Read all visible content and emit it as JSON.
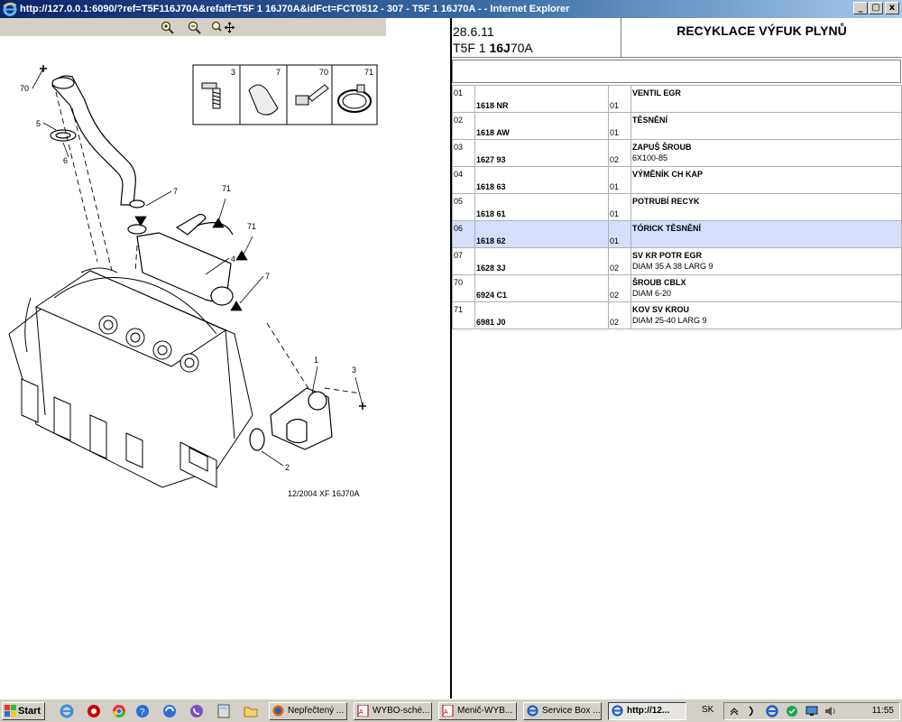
{
  "window": {
    "title": "http://127.0.0.1:6090/?ref=T5F116J70A&refaff=T5F 1 16J70A&idFct=FCT0512 - 307 - T5F 1 16J70A - - Internet Explorer"
  },
  "toolbar": {
    "zoom_in": "zoom-in",
    "zoom_out": "zoom-out",
    "zoom_pan": "zoom-pan"
  },
  "diagram": {
    "callouts": [
      "70",
      "5",
      "6",
      "7",
      "71",
      "4",
      "71",
      "7",
      "1",
      "3",
      "2"
    ],
    "legend": [
      {
        "num": "3",
        "part": "screw"
      },
      {
        "num": "7",
        "part": "clamp"
      },
      {
        "num": "70",
        "part": "screw"
      },
      {
        "num": "71",
        "part": "hose-clip"
      }
    ],
    "caption": "12/2004  XF 16J70A"
  },
  "header": {
    "date": "28.6.11",
    "model_prefix": "T5F 1",
    "model_bold": "16J",
    "model_suffix": "70A",
    "title": "RECYKLACE VÝFUK PLYNŮ"
  },
  "parts": [
    {
      "no": "01",
      "ref": "1618 NR",
      "qty": "01",
      "desc": "VENTIL EGR",
      "desc2": ""
    },
    {
      "no": "02",
      "ref": "1618 AW",
      "qty": "01",
      "desc": "TĚSNĚNÍ",
      "desc2": ""
    },
    {
      "no": "03",
      "ref": "1627 93",
      "qty": "02",
      "desc": "ZAPUŠ ŠROUB",
      "desc2": "6X100-85"
    },
    {
      "no": "04",
      "ref": "1618 63",
      "qty": "01",
      "desc": "VÝMĚNÍK CH KAP",
      "desc2": ""
    },
    {
      "no": "05",
      "ref": "1618 61",
      "qty": "01",
      "desc": "POTRUBÍ RECYK",
      "desc2": ""
    },
    {
      "no": "06",
      "ref": "1618 62",
      "qty": "01",
      "desc": "TÓRICK TĚSNĚNÍ",
      "desc2": ""
    },
    {
      "no": "07",
      "ref": "1628 3J",
      "qty": "02",
      "desc": "SV KR POTR EGR",
      "desc2": "DIAM 35 A 38 LARG 9"
    },
    {
      "no": "70",
      "ref": "6924 C1",
      "qty": "02",
      "desc": "ŠROUB CBLX",
      "desc2": "DIAM 6-20"
    },
    {
      "no": "71",
      "ref": "6981 J0",
      "qty": "02",
      "desc": "KOV SV KROU",
      "desc2": "DIAM 25-40 LARG 9"
    }
  ],
  "taskbar": {
    "start": "Start",
    "tasks": [
      {
        "label": "Nepřečtený ...",
        "icon": "firefox-icon"
      },
      {
        "label": "WYBO-sché...",
        "icon": "pdf-icon"
      },
      {
        "label": "Menič-WYB...",
        "icon": "pdf-icon"
      },
      {
        "label": "Service Box ...",
        "icon": "ie-icon"
      },
      {
        "label": "http://12...",
        "icon": "ie-icon"
      }
    ],
    "lang": "SK",
    "clock": "11:55"
  },
  "colors": {
    "titlebar_start": "#0a246a",
    "titlebar_end": "#a6caf0",
    "selected_row": "#d5dffb",
    "chrome": "#d4d0c8"
  }
}
